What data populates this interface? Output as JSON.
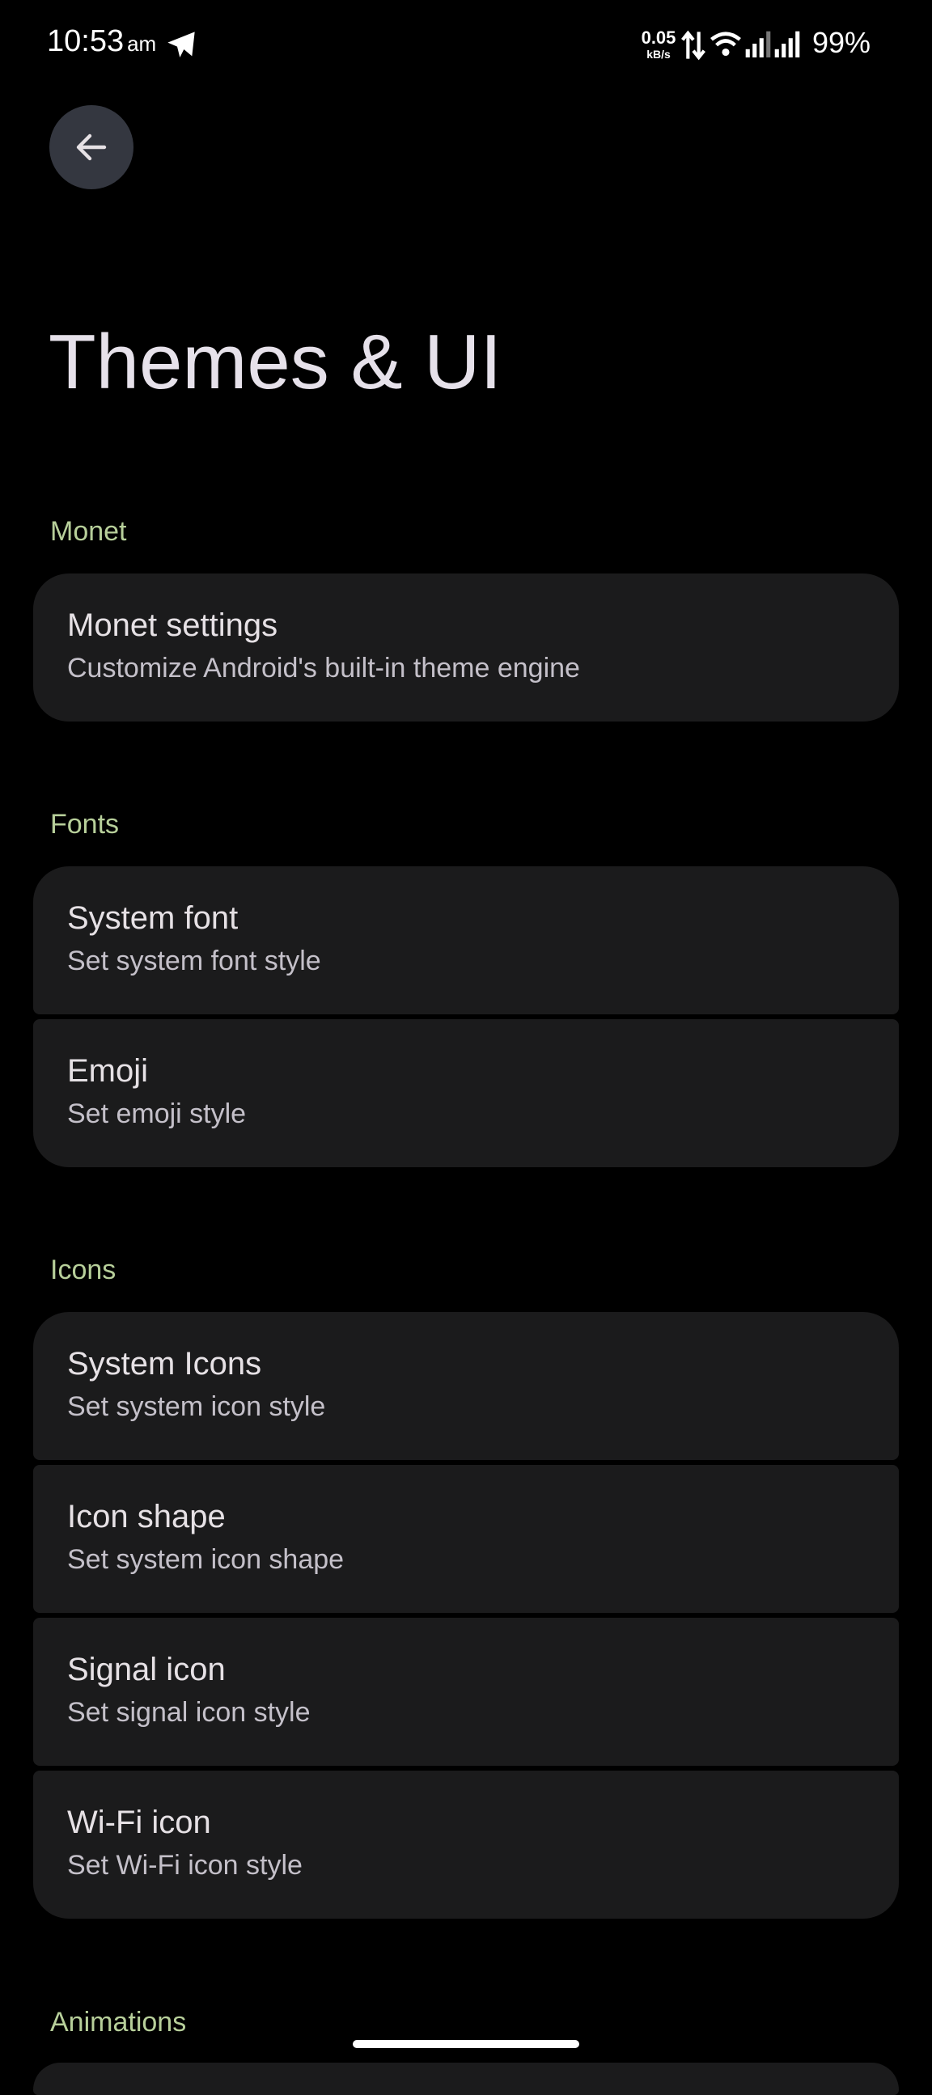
{
  "status_bar": {
    "time": "10:53",
    "ampm": "am",
    "net_speed_value": "0.05",
    "net_speed_unit": "kB/s",
    "battery": "99%",
    "icons": [
      "telegram-icon",
      "data-arrows-icon",
      "wifi-icon",
      "signal-icon",
      "signal-icon"
    ]
  },
  "header": {
    "back_icon": "arrow-left-icon",
    "title": "Themes & UI"
  },
  "sections": [
    {
      "header": "Monet",
      "items": [
        {
          "title": "Monet settings",
          "subtitle": "Customize Android's built-in theme engine"
        }
      ]
    },
    {
      "header": "Fonts",
      "items": [
        {
          "title": "System font",
          "subtitle": "Set system font style"
        },
        {
          "title": "Emoji",
          "subtitle": "Set emoji style"
        }
      ]
    },
    {
      "header": "Icons",
      "items": [
        {
          "title": "System Icons",
          "subtitle": "Set system icon style"
        },
        {
          "title": "Icon shape",
          "subtitle": "Set system icon shape"
        },
        {
          "title": "Signal icon",
          "subtitle": "Set signal icon style"
        },
        {
          "title": "Wi-Fi icon",
          "subtitle": "Set Wi-Fi icon style"
        }
      ]
    },
    {
      "header": "Animations",
      "items": []
    }
  ],
  "colors": {
    "background": "#000000",
    "card": "#1b1b1c",
    "section_header": "#b7cf9a",
    "back_button_bg": "#343740"
  }
}
